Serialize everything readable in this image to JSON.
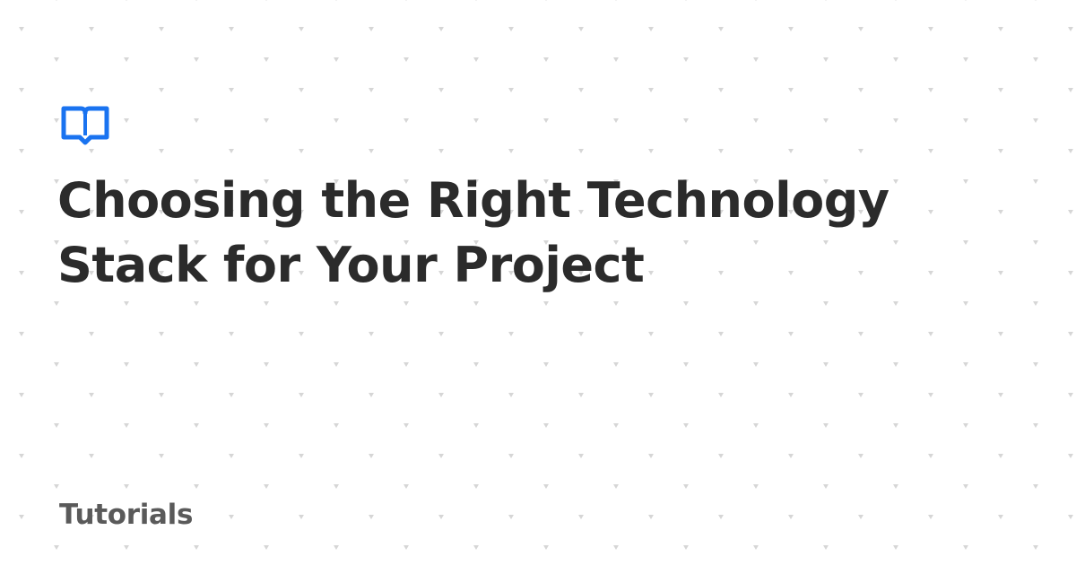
{
  "title": "Choosing the Right Technology Stack for Your Project",
  "category": "Tutorials",
  "logo": {
    "icon": "open-book-icon",
    "color": "#1a73f0"
  },
  "colors": {
    "background": "#ffffff",
    "title": "#2b2b2b",
    "category": "#5a5a5a",
    "pattern": "#d4d4d4"
  }
}
